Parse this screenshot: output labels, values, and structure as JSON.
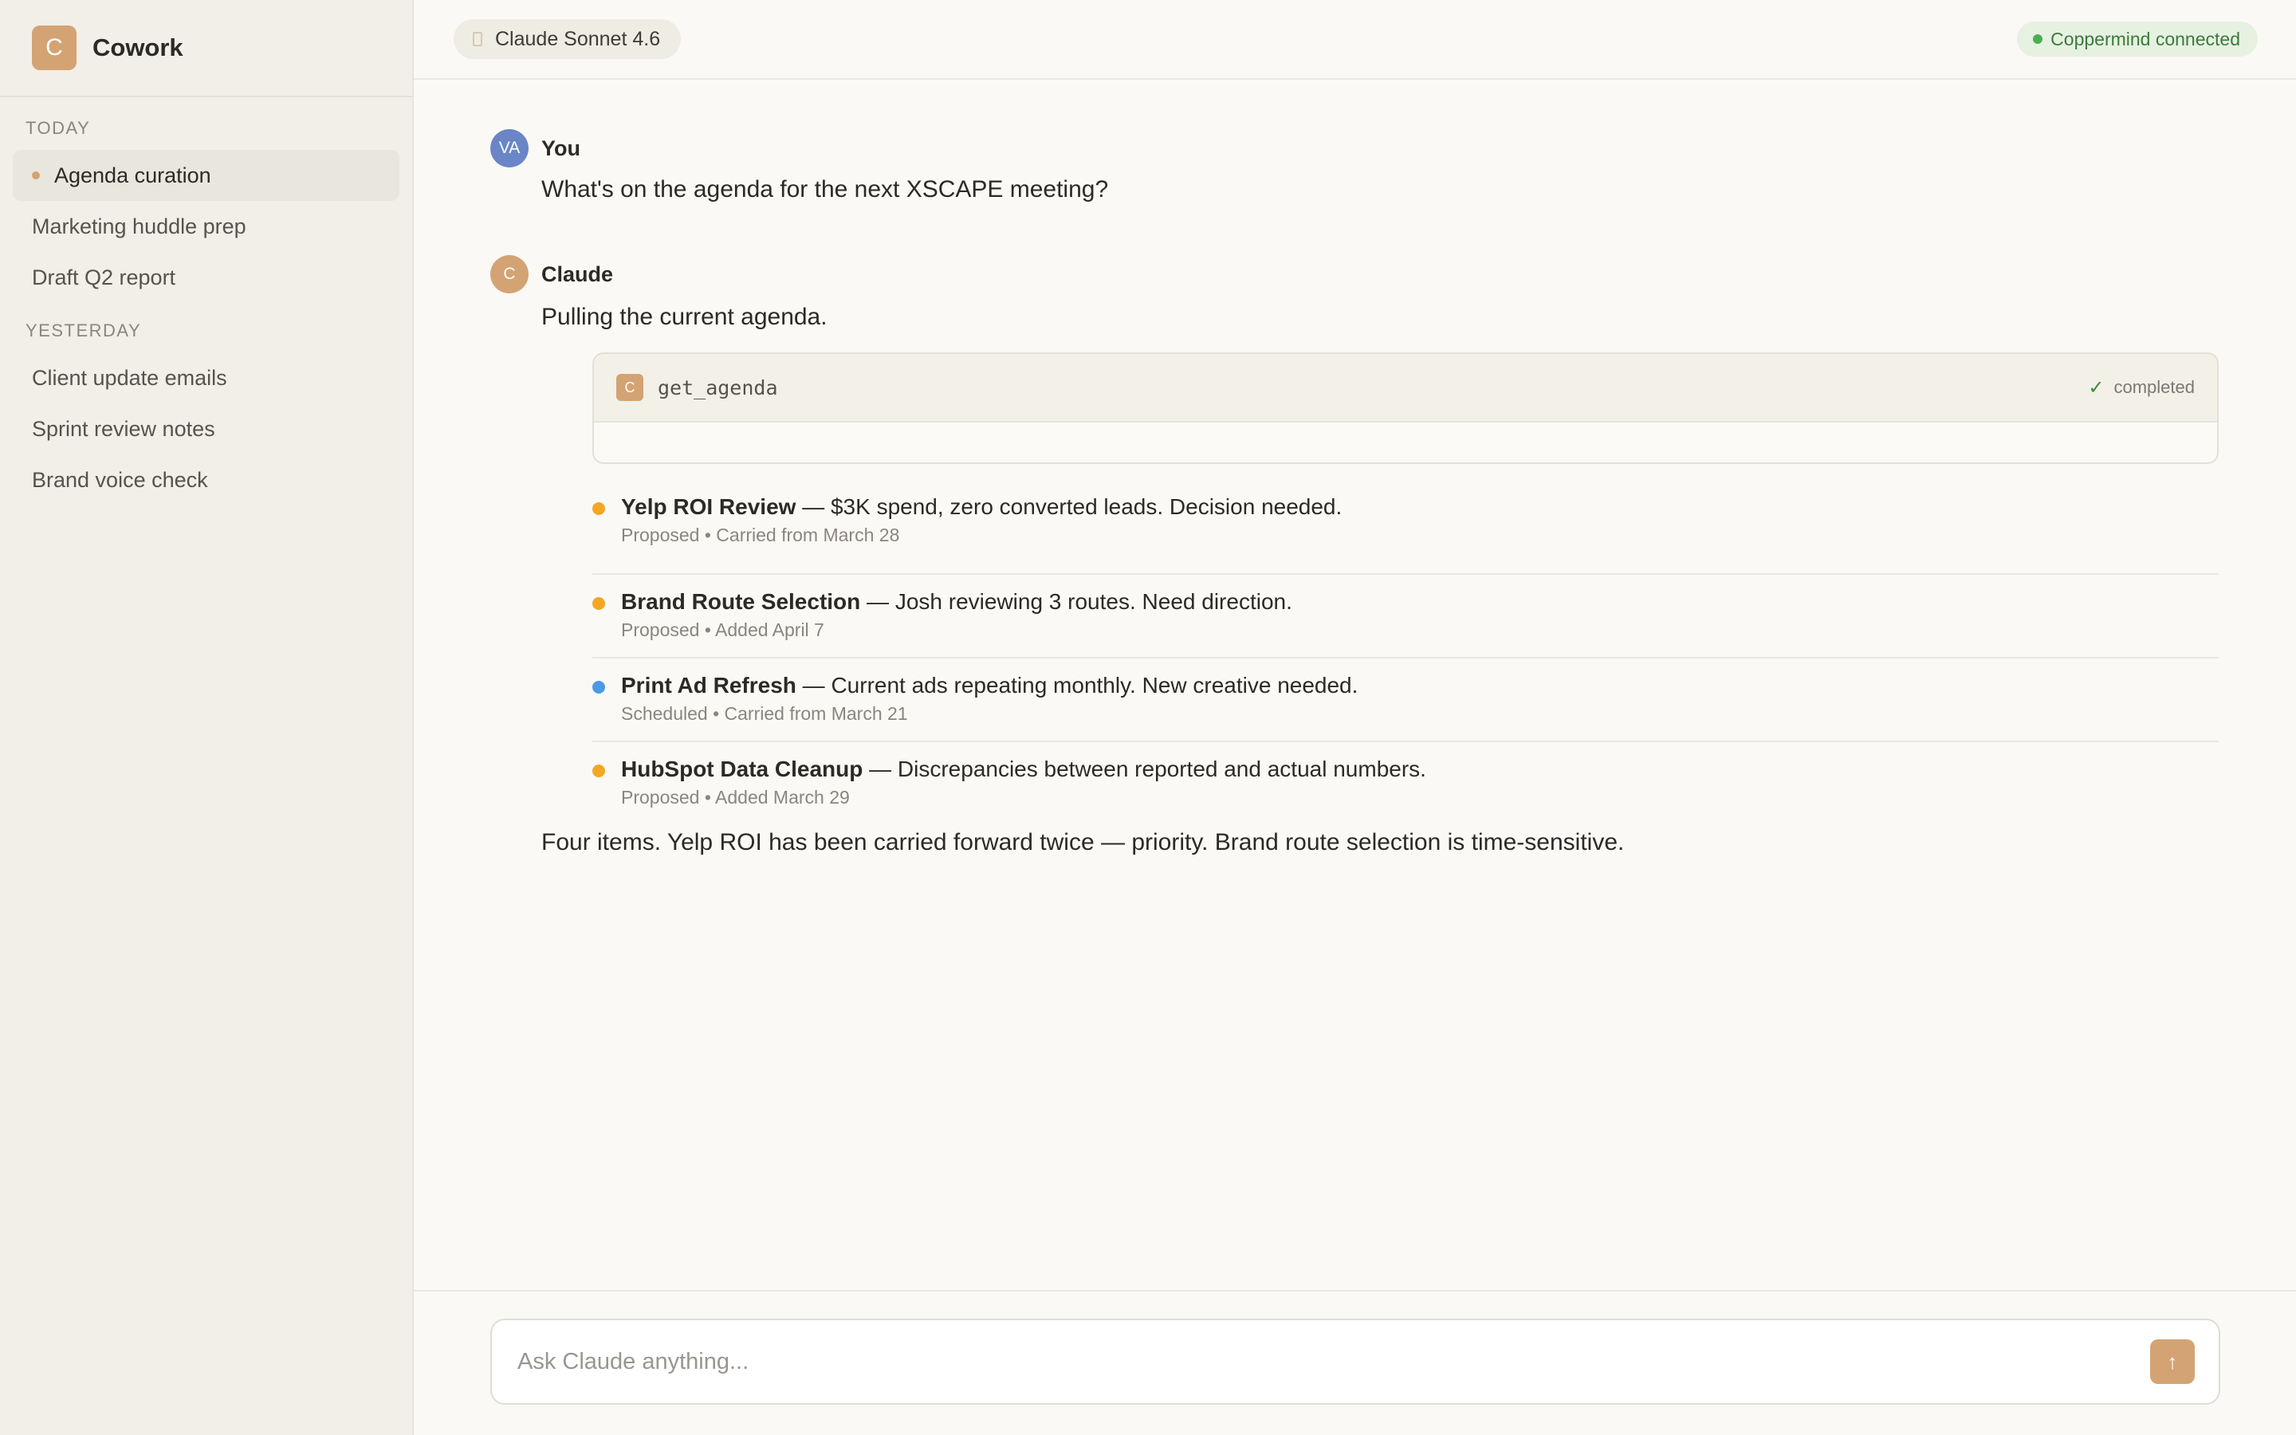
{
  "app": {
    "logo": "C",
    "name": "Cowork"
  },
  "sidebar": {
    "sections": [
      {
        "label": "TODAY",
        "items": [
          "Agenda curation",
          "Marketing huddle prep",
          "Draft Q2 report"
        ]
      },
      {
        "label": "YESTERDAY",
        "items": [
          "Client update emails",
          "Sprint review notes",
          "Brand voice check"
        ]
      }
    ],
    "active_item": "Agenda curation"
  },
  "topbar": {
    "model": "Claude Sonnet 4.6",
    "connection": "Coppermind connected"
  },
  "messages": {
    "user": {
      "avatar": "VA",
      "author": "You",
      "text": "What's on the agenda for the next XSCAPE meeting?"
    },
    "assistant": {
      "avatar": "C",
      "author": "Claude",
      "intro": "Pulling the current agenda.",
      "tool": {
        "icon": "C",
        "name": "get_agenda",
        "status_icon": "✓",
        "status": "completed"
      },
      "agenda": [
        {
          "title": "Yelp ROI Review",
          "detail": " — $3K spend, zero converted leads. Decision needed.",
          "meta": "Proposed • Carried from March 28",
          "dot_color": "#f5a623"
        },
        {
          "title": "Brand Route Selection",
          "detail": " — Josh reviewing 3 routes. Need direction.",
          "meta": "Proposed • Added April 7",
          "dot_color": "#f5a623"
        },
        {
          "title": "Print Ad Refresh",
          "detail": " — Current ads repeating monthly. New creative needed.",
          "meta": "Scheduled • Carried from March 21",
          "dot_color": "#4a9ae8"
        },
        {
          "title": "HubSpot Data Cleanup",
          "detail": " — Discrepancies between reported and actual numbers.",
          "meta": "Proposed • Added March 29",
          "dot_color": "#f5a623"
        }
      ],
      "summary": "Four items. Yelp ROI has been carried forward twice — priority. Brand route selection is time-sensitive."
    }
  },
  "composer": {
    "placeholder": "Ask Claude anything...",
    "send_icon": "↑"
  }
}
